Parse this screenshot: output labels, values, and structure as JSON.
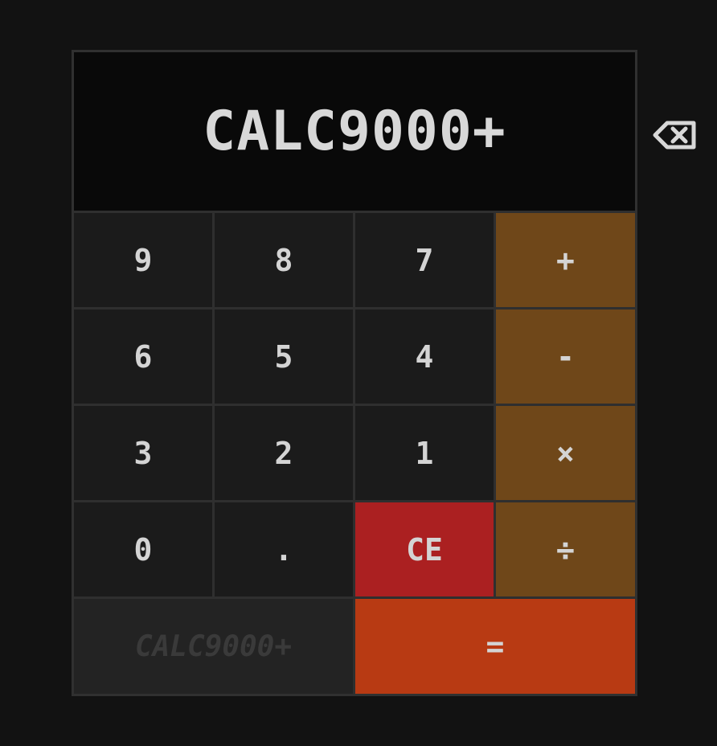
{
  "display": {
    "value": "CALC9000+"
  },
  "backspace": {
    "icon": "backspace-icon"
  },
  "keys": {
    "k9": "9",
    "k8": "8",
    "k7": "7",
    "plus": "+",
    "k6": "6",
    "k5": "5",
    "k4": "4",
    "minus": "-",
    "k3": "3",
    "k2": "2",
    "k1": "1",
    "multiply": "×",
    "k0": "0",
    "dot": ".",
    "ce": "CE",
    "divide": "÷",
    "brand": "CALC9000+",
    "equals": "="
  },
  "colors": {
    "background": "#121212",
    "display": "#090909",
    "digit_key": "#1b1b1b",
    "operator_key": "#6f4719",
    "clear_key": "#ab2021",
    "equals_key": "#b83a13",
    "brand_panel": "#232323",
    "text": "#d4d4d4"
  }
}
